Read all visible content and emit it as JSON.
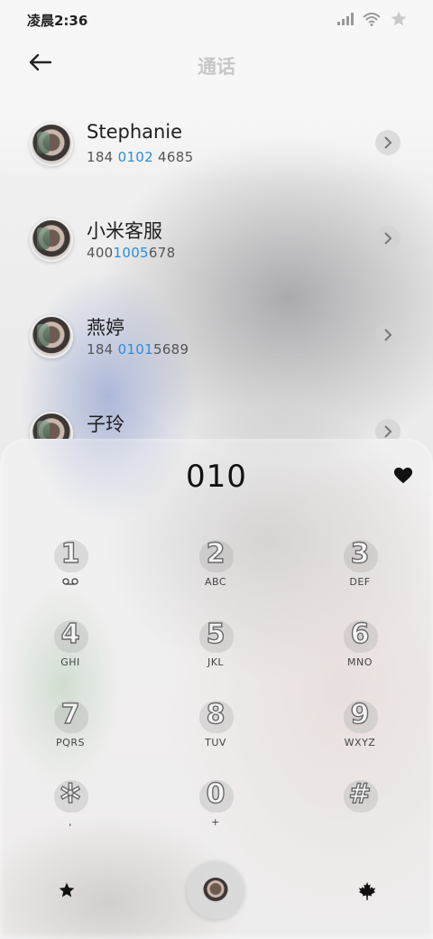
{
  "status_bar": {
    "time": "凌晨2:36"
  },
  "header": {
    "title": "通话"
  },
  "contacts": [
    {
      "name": "Stephanie",
      "number_before": "184 ",
      "number_match": "0102",
      "number_after": " 4685"
    },
    {
      "name": "小米客服",
      "number_before": "400",
      "number_match": "1005",
      "number_after": "678"
    },
    {
      "name": "燕婷",
      "number_before": "184 ",
      "number_match": "0101",
      "number_after": "5689"
    },
    {
      "name": "子玲",
      "number_before": "",
      "number_match": "",
      "number_after": ""
    }
  ],
  "dialpad": {
    "typed_digits": "010",
    "keys": [
      {
        "digit": "1",
        "sub": ""
      },
      {
        "digit": "2",
        "sub": "ABC"
      },
      {
        "digit": "3",
        "sub": "DEF"
      },
      {
        "digit": "4",
        "sub": "GHI"
      },
      {
        "digit": "5",
        "sub": "JKL"
      },
      {
        "digit": "6",
        "sub": "MNO"
      },
      {
        "digit": "7",
        "sub": "PQRS"
      },
      {
        "digit": "8",
        "sub": "TUV"
      },
      {
        "digit": "9",
        "sub": "WXYZ"
      },
      {
        "digit": "✲",
        "sub": ","
      },
      {
        "digit": "0",
        "sub": "+"
      },
      {
        "digit": "#",
        "sub": ""
      }
    ]
  },
  "icons": {
    "back": "arrow-left-icon",
    "favorite": "heart-icon",
    "voicemail": "voicemail-icon",
    "nav_left": "star-icon",
    "nav_right": "maple-leaf-icon"
  }
}
